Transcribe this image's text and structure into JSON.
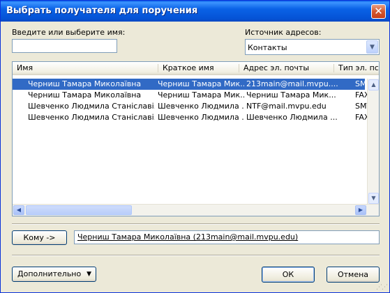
{
  "dialog": {
    "title": "Выбрать получателя для поручения",
    "close_glyph": "✕"
  },
  "name_search": {
    "label": "Введите или выберите имя:",
    "value": ""
  },
  "address_source": {
    "label": "Источник адресов:",
    "selected": "Контакты"
  },
  "table": {
    "columns": [
      "Имя",
      "Краткое имя",
      "Адрес эл. почты",
      "Тип эл. пс"
    ],
    "rows": [
      {
        "name": "Черниш Тамара Миколаївна",
        "short": "Черниш Тамара Мик...",
        "email": "213main@mail.mvpu....",
        "type": "SMTP",
        "selected": true
      },
      {
        "name": "Черниш Тамара Миколаївна",
        "short": "Черниш Тамара Мик...",
        "email": "Черниш Тамара Мик...",
        "type": "FAX",
        "selected": false
      },
      {
        "name": "Шевченко Людмила Станіславі...",
        "short": "Шевченко Людмила ...",
        "email": "NTF@mail.mvpu.edu",
        "type": "SMTP",
        "selected": false
      },
      {
        "name": "Шевченко Людмила Станіславі...",
        "short": "Шевченко Людмила ...",
        "email": "Шевченко Людмила ...",
        "type": "FAX",
        "selected": false
      }
    ]
  },
  "to": {
    "button_label": "Кому ->",
    "value": "Черниш Тамара Миколаївна (213main@mail.mvpu.edu)"
  },
  "footer": {
    "advanced_label": "Дополнительно",
    "ok_label": "ОК",
    "cancel_label": "Отмена"
  },
  "icons": {
    "dropdown": "chevron-down-icon",
    "scroll_up": "arrow-up-icon",
    "scroll_down": "arrow-down-icon",
    "scroll_left": "arrow-left-icon",
    "scroll_right": "arrow-right-icon",
    "grip": "size-grip-icon"
  },
  "colors": {
    "selection": "#316ac5",
    "titlebar": "#0a5fe8",
    "face": "#ece9d8"
  }
}
